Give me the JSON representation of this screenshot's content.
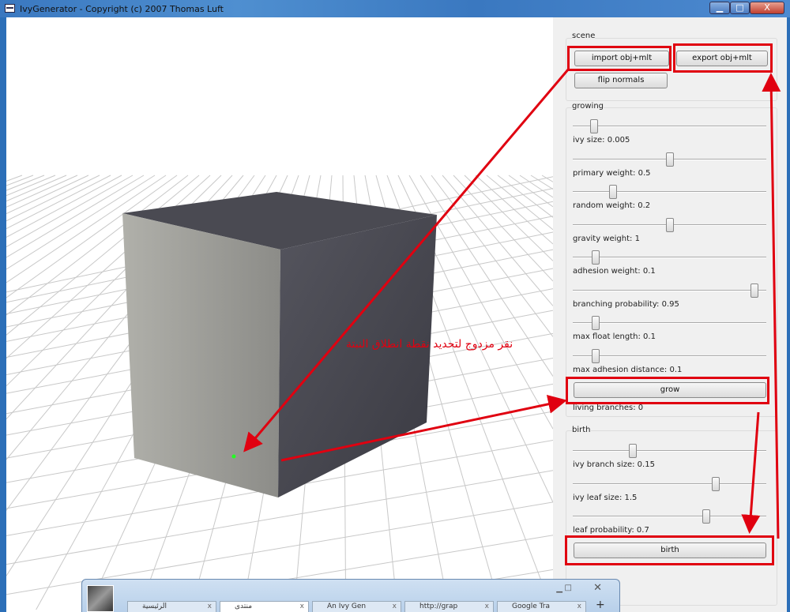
{
  "window": {
    "title": "IvyGenerator  - Copyright (c) 2007 Thomas Luft",
    "minimize": "▁",
    "maximize": "□",
    "close": "X"
  },
  "scene": {
    "label": "scene",
    "import": "import obj+mlt",
    "export": "export obj+mlt",
    "flip": "flip normals"
  },
  "growing": {
    "label": "growing",
    "sliders": [
      {
        "label": "ivy size: 0.005",
        "position": 0.11
      },
      {
        "label": "primary weight: 0.5",
        "position": 0.5
      },
      {
        "label": "random weight: 0.2",
        "position": 0.21
      },
      {
        "label": "gravity weight: 1",
        "position": 0.5
      },
      {
        "label": "adhesion weight: 0.1",
        "position": 0.12
      },
      {
        "label": "branching probability: 0.95",
        "position": 0.94
      },
      {
        "label": "max float length: 0.1",
        "position": 0.12
      },
      {
        "label": "max adhesion distance: 0.1",
        "position": 0.12
      }
    ],
    "grow": "grow",
    "living": "living branches: 0"
  },
  "birth": {
    "label": "birth",
    "sliders": [
      {
        "label": "ivy branch size: 0.15",
        "position": 0.31
      },
      {
        "label": "ivy leaf size: 1.5",
        "position": 0.74
      },
      {
        "label": "leaf probability: 0.7",
        "position": 0.69
      }
    ],
    "button": "birth"
  },
  "annotation": {
    "text": "نقر مزدوج لتحديد نقطة انطلاق النبتة",
    "color": "#e00010"
  },
  "taskbar": {
    "tabs": [
      "الرئيسية",
      "منتدى",
      "An Ivy Gen",
      "http://grap",
      "Google Tra"
    ],
    "new_tab": "+"
  }
}
